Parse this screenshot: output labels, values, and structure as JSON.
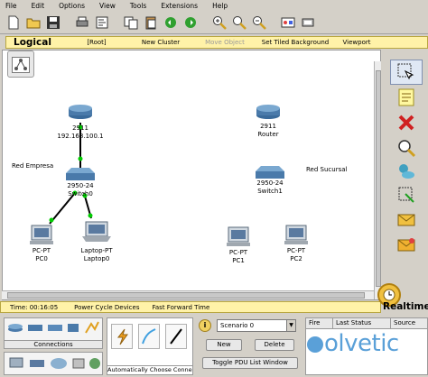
{
  "menu": [
    "File",
    "Edit",
    "Options",
    "View",
    "Tools",
    "Extensions",
    "Help"
  ],
  "toolbar_icons": [
    "new-icon",
    "open-icon",
    "save-icon",
    "print-icon",
    "activity-wizard-icon",
    "copy-icon",
    "paste-icon",
    "undo-icon",
    "redo-icon",
    "zoom-in-icon",
    "zoom-reset-icon",
    "zoom-out-icon",
    "drawing-palette-icon",
    "custom-devices-icon"
  ],
  "logical_bar": {
    "title": "Logical",
    "root": "[Root]",
    "new_cluster": "New Cluster",
    "move_object": "Move Object",
    "set_tiled_background": "Set Tiled Background",
    "viewport": "Viewport"
  },
  "workspace": {
    "labels": {
      "red_empresa": "Red Empresa",
      "red_sucursal": "Red Sucursal"
    },
    "devices": {
      "router0": {
        "model": "2911",
        "name": "192.168.100.1"
      },
      "switch0": {
        "model": "2950-24",
        "name": "Switch0"
      },
      "pc0": {
        "model": "PC-PT",
        "name": "PC0"
      },
      "laptop0": {
        "model": "Laptop-PT",
        "name": "Laptop0"
      },
      "router1": {
        "model": "2911",
        "name": "Router"
      },
      "switch1": {
        "model": "2950-24",
        "name": "Switch1"
      },
      "pc1": {
        "model": "PC-PT",
        "name": "PC1"
      },
      "pc2": {
        "model": "PC-PT",
        "name": "PC2"
      }
    },
    "colors": {
      "link": "#000000",
      "link_up": "#00cc00"
    }
  },
  "palette_icons": [
    "select-icon",
    "note-icon",
    "delete-icon",
    "inspect-icon",
    "draw-shape-icon",
    "resize-icon",
    "add-simple-pdu-icon",
    "add-complex-pdu-icon"
  ],
  "status_bar": {
    "time": "Time: 00:16:05",
    "power_cycle": "Power Cycle Devices",
    "fast_forward": "Fast Forward Time"
  },
  "realtime": {
    "label": "Realtime"
  },
  "device_panel": {
    "category_label": "Connections",
    "auto_connection": "Automatically Choose Connection Type"
  },
  "scenario": {
    "selected": "Scenario 0",
    "new_button": "New",
    "delete_button": "Delete",
    "toggle_button": "Toggle PDU List Window"
  },
  "pdu_table": {
    "columns": [
      "Fire",
      "Last Status",
      "Source"
    ]
  },
  "watermark": "olvetic"
}
